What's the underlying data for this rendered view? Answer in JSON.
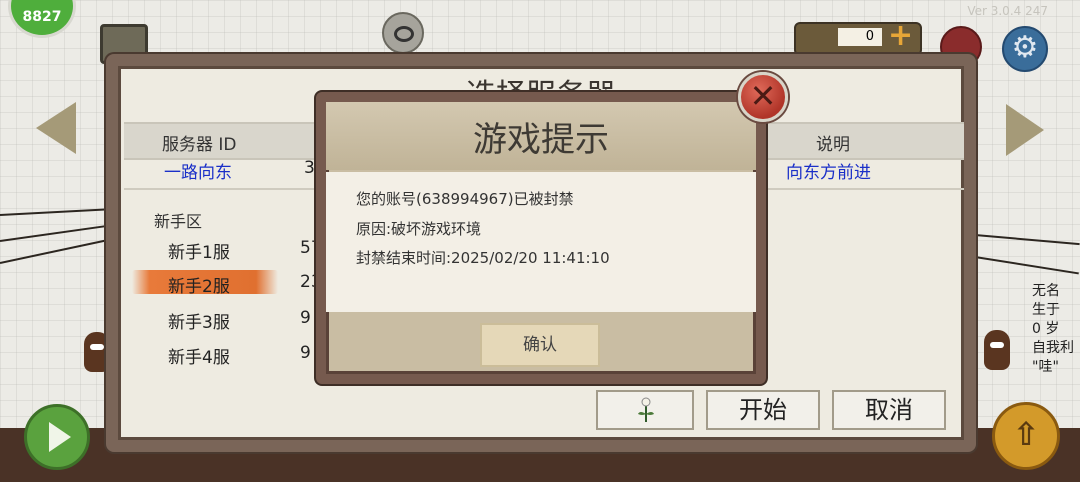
{
  "hud": {
    "badge_text": "8827",
    "version": "Ver 3.0.4 247",
    "gold_count": "0",
    "gold_plus": "+",
    "gear": "⚙",
    "up_arrow": "⇧"
  },
  "server_panel": {
    "title": "选择服务器",
    "columns": {
      "id": "服务器 ID",
      "desc": "说明"
    },
    "featured": {
      "name": "一路向东",
      "value": "3",
      "desc": "向东方前进"
    },
    "zone_label": "新手区",
    "servers": [
      {
        "name": "新手1服",
        "value": "57"
      },
      {
        "name": "新手2服",
        "value": "23"
      },
      {
        "name": "新手3服",
        "value": "9"
      },
      {
        "name": "新手4服",
        "value": "9"
      }
    ],
    "start_label": "开始",
    "cancel_label": "取消"
  },
  "dialog": {
    "title": "游戏提示",
    "lines": [
      "您的账号(638994967)已被封禁",
      "原因:破坏游戏环境",
      "封禁结束时间:2025/02/20 11:41:10"
    ],
    "confirm_label": "确认",
    "close_glyph": "✕"
  },
  "side_info": {
    "text": "无名\n生于\n0 岁\n自我利\n\"哇\""
  }
}
